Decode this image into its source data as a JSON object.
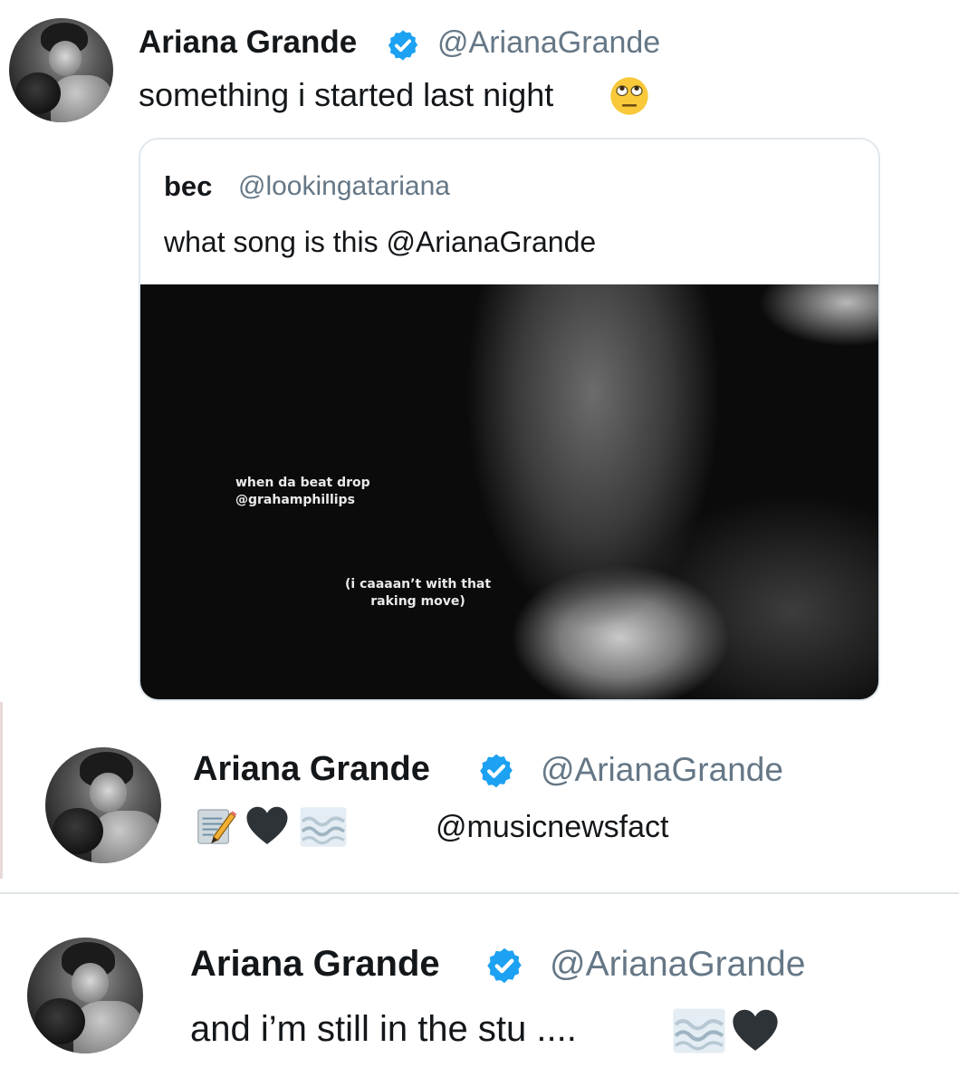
{
  "tweets": [
    {
      "name": "Ariana Grande",
      "handle": "@ArianaGrande",
      "text": "something i started last night",
      "emoji": [
        "face-with-rolling-eyes-emoji"
      ]
    },
    {
      "name": "Ariana Grande",
      "handle": "@ArianaGrande",
      "text": "",
      "emoji": [
        "memo-emoji",
        "black-heart-emoji",
        "water-wave-emoji"
      ]
    },
    {
      "name": "Ariana Grande",
      "handle": "@ArianaGrande",
      "text": "and i’m still in the stu ....",
      "emoji": [
        "water-wave-emoji",
        "black-heart-emoji"
      ]
    }
  ],
  "quote": {
    "name": "bec",
    "handle": "@lookingatariana",
    "text": "what song is this @ArianaGrande",
    "media_caption_1": "when da beat drop",
    "media_caption_2": "@grahamphillips",
    "media_caption_3": "(i caaaan’t with that",
    "media_caption_4": "raking move)"
  },
  "watermark": "@musicnewsfact",
  "colors": {
    "verified_blue": "#1da1f2",
    "handle_gray": "#657786",
    "text_dark": "#14171a",
    "border": "#e1e8ed"
  }
}
